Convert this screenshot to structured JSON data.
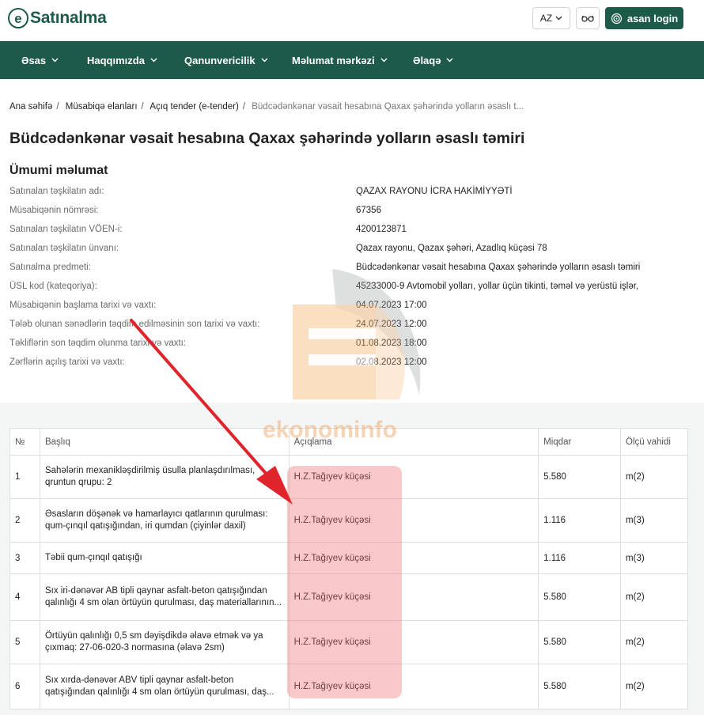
{
  "header": {
    "logo_letter": "e",
    "logo_text": "Satınalma",
    "language": "AZ",
    "login_label": "asan login"
  },
  "nav": [
    {
      "label": "Əsas"
    },
    {
      "label": "Haqqımızda"
    },
    {
      "label": "Qanunvericilik"
    },
    {
      "label": "Məlumat mərkəzi"
    },
    {
      "label": "Əlaqə"
    }
  ],
  "breadcrumb": [
    "Ana səhifə",
    "Müsabiqə elanları",
    "Açıq tender (e-tender)",
    "Büdcədənkənar vəsait hesabına Qaxax şəhərində yolların əsaslı t..."
  ],
  "page_title": "Büdcədənkənar vəsait hesabına Qaxax şəhərində yolların əsaslı təmiri",
  "general_info": {
    "title": "Ümumi məlumat",
    "rows": [
      {
        "key": "Satınalan təşkilatın adı:",
        "value": "QAZAX RAYONU İCRA HAKİMİYYƏTİ"
      },
      {
        "key": "Müsabiqənin nömrəsi:",
        "value": "67356"
      },
      {
        "key": "Satınalan təşkilatın VÖEN-i:",
        "value": "4200123871"
      },
      {
        "key": "Satınalan təşkilatın ünvanı:",
        "value": "Qazax rayonu, Qazax şəhəri, Azadlıq küçəsi 78"
      },
      {
        "key": "Satınalma predmeti:",
        "value": "Büdcədənkənar vəsait hesabına Qaxax şəhərində yolların əsaslı təmiri"
      },
      {
        "key": "ÜSL kod (kateqoriya):",
        "value": "45233000-9 Avtomobil yolları, yollar üçün tikinti, təməl və yerüstü işlər,"
      },
      {
        "key": "Müsabiqənin başlama tarixi və vaxtı:",
        "value": "04.07.2023 17:00"
      },
      {
        "key": "Tələb olunan sənədlərin təqdim edilməsinin son tarixi və vaxtı:",
        "value": "24.07.2023 12:00"
      },
      {
        "key": "Təkliflərin son təqdim olunma tarixi və vaxtı:",
        "value": "01.08.2023 18:00"
      },
      {
        "key": "Zərflərin açılış tarixi və vaxtı:",
        "value": "02.08.2023 12:00"
      }
    ]
  },
  "table": {
    "headers": [
      "№",
      "Başlıq",
      "Açıqlama",
      "Miqdar",
      "Ölçü vahidi"
    ],
    "rows": [
      {
        "no": "1",
        "title": "Sahələrin mexanikləşdirilmiş üsulla planlaşdırılması, qruntun qrupu: 2",
        "desc": "H.Z.Tağıyev küçəsi",
        "qty": "5.580",
        "unit": "m(2)"
      },
      {
        "no": "2",
        "title": "Əsasların döşənək və hamarlayıcı qatlarının qurulması: qum-çınqıl qatışığından, iri qumdan (çiyinlər daxil)",
        "desc": "H.Z.Tağıyev küçəsi",
        "qty": "1.116",
        "unit": "m(3)"
      },
      {
        "no": "3",
        "title": "Təbii qum-çınqıl qatışığı",
        "desc": "H.Z.Tağıyev küçəsi",
        "qty": "1.116",
        "unit": "m(3)"
      },
      {
        "no": "4",
        "title": "Sıx iri-dənəvər AB tipli qaynar asfalt-beton qatışığından qalınlığı 4 sm olan örtüyün qurulması, daş materiallarının...",
        "desc": "H.Z.Tağıyev küçəsi",
        "qty": "5.580",
        "unit": "m(2)"
      },
      {
        "no": "5",
        "title": "Örtüyün qalınlığı 0,5 sm dəyişdikdə əlavə etmək və ya çıxmaq: 27-06-020-3 normasına (əlavə 2sm)",
        "desc": "H.Z.Tağıyev küçəsi",
        "qty": "5.580",
        "unit": "m(2)"
      },
      {
        "no": "6",
        "title": "Sıx xırda-dənəvər ABV tipli qaynar asfalt-beton qatışığından qalınlığı 4 sm olan örtüyün qurulması, daş...",
        "desc": "H.Z.Tağıyev küçəsi",
        "qty": "5.580",
        "unit": "m(2)"
      }
    ]
  },
  "watermark": "ekonominfo",
  "colors": {
    "brand": "#1e5a4a",
    "highlight": "#f06e6e",
    "arrow": "#e0242c"
  }
}
